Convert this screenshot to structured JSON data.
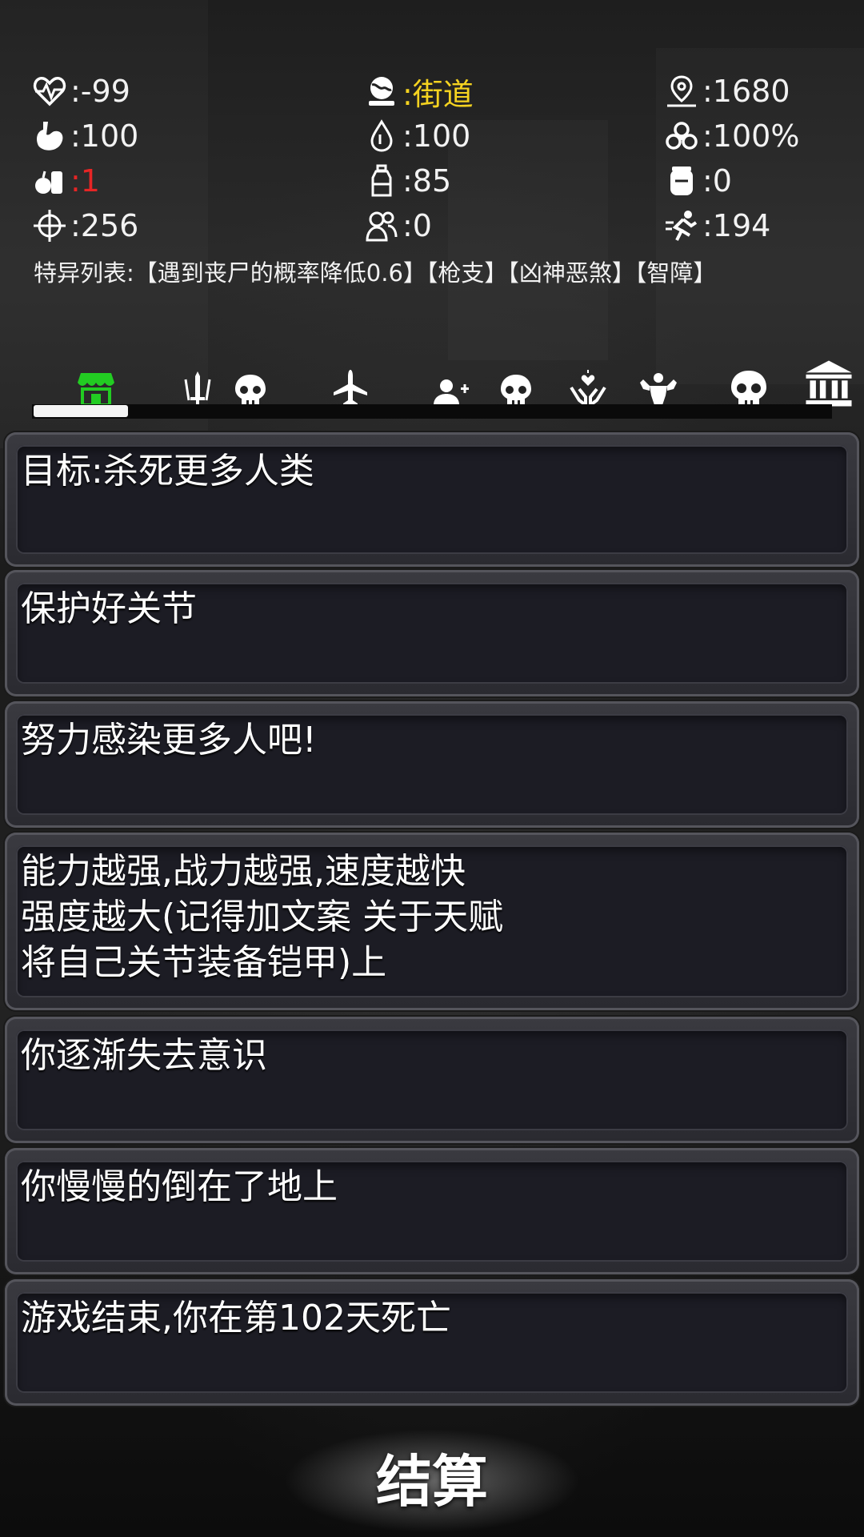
{
  "stats": {
    "health": ":-99",
    "location": ":街道",
    "distance": ":1680",
    "hunger": ":100",
    "thirst": ":100",
    "infection": ":100%",
    "food": ":1",
    "water": ":85",
    "ammo_box": ":0",
    "accuracy": ":256",
    "companions": ":0",
    "speed": ":194"
  },
  "traits": "特异列表:【遇到丧尸的概率降低0.6】【枪支】【凶神恶煞】【智障】",
  "tabs": [
    {
      "name": "shop-icon",
      "active": true,
      "color": "#22cc22"
    },
    {
      "name": "weapons-icon"
    },
    {
      "name": "skull-icon"
    },
    {
      "name": "plane-icon"
    },
    {
      "name": "add-person-icon"
    },
    {
      "name": "skull-icon-2"
    },
    {
      "name": "heart-hands-icon"
    },
    {
      "name": "strength-icon"
    },
    {
      "name": "skull-icon-3"
    },
    {
      "name": "bank-icon"
    }
  ],
  "log": [
    "目标:杀死更多人类",
    "保护好关节",
    "努力感染更多人吧!",
    "能力越强,战力越强,速度越快\n强度越大(记得加文案 关于天赋\n将自己关节装备铠甲)上",
    "你逐渐失去意识",
    "你慢慢的倒在了地上",
    "游戏结束,你在第102天死亡"
  ],
  "settle_label": "结算",
  "colors": {
    "location": "#f5d320",
    "food": "#e62525",
    "active_tab": "#22cc22"
  }
}
